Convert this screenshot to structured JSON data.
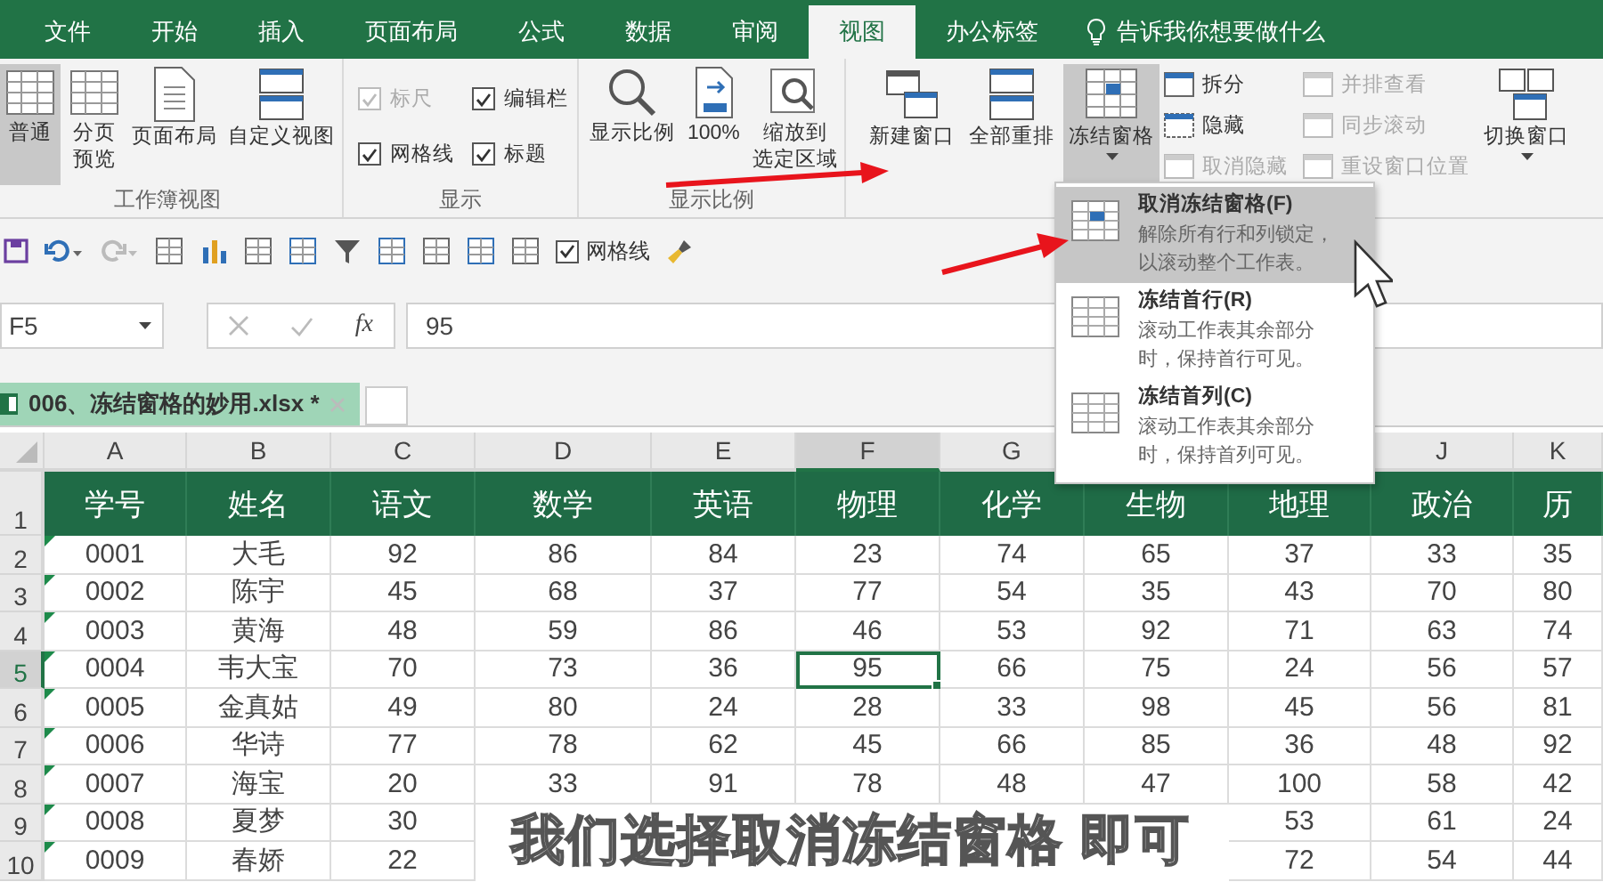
{
  "menu_tabs": [
    {
      "label": "文件",
      "selected": false
    },
    {
      "label": "开始",
      "selected": false
    },
    {
      "label": "插入",
      "selected": false
    },
    {
      "label": "页面布局",
      "selected": false
    },
    {
      "label": "公式",
      "selected": false
    },
    {
      "label": "数据",
      "selected": false
    },
    {
      "label": "审阅",
      "selected": false
    },
    {
      "label": "视图",
      "selected": true
    },
    {
      "label": "办公标签",
      "selected": false
    }
  ],
  "tell_me": {
    "placeholder": "告诉我你想要做什么"
  },
  "workbook_views": {
    "label": "工作簿视图",
    "buttons": [
      {
        "lines": [
          "普通"
        ],
        "selected": true
      },
      {
        "lines": [
          "分页",
          "预览"
        ],
        "selected": false
      },
      {
        "lines": [
          "页面布局"
        ],
        "selected": false
      },
      {
        "lines": [
          "自定义视图"
        ],
        "selected": false
      }
    ]
  },
  "show": {
    "label": "显示",
    "checkboxes": [
      {
        "label": "标尺",
        "checked": true,
        "disabled": true
      },
      {
        "label": "编辑栏",
        "checked": true,
        "disabled": false
      },
      {
        "label": "网格线",
        "checked": true,
        "disabled": false
      },
      {
        "label": "标题",
        "checked": true,
        "disabled": false
      }
    ]
  },
  "zoom": {
    "label": "显示比例",
    "buttons": [
      {
        "lines": [
          "显示比例"
        ]
      },
      {
        "lines": [
          "100%"
        ]
      },
      {
        "lines": [
          "缩放到",
          "选定区域"
        ]
      }
    ]
  },
  "window": {
    "large": [
      {
        "label": "新建窗口",
        "pressed": false,
        "dropdown": false
      },
      {
        "label": "全部重排",
        "pressed": false,
        "dropdown": false
      },
      {
        "label": "冻结窗格",
        "pressed": true,
        "dropdown": true
      }
    ],
    "small_left": [
      {
        "label": "拆分",
        "disabled": false
      },
      {
        "label": "隐藏",
        "disabled": false
      },
      {
        "label": "取消隐藏",
        "disabled": true
      }
    ],
    "small_right": [
      {
        "label": "并排查看",
        "disabled": true
      },
      {
        "label": "同步滚动",
        "disabled": true
      },
      {
        "label": "重设窗口位置",
        "disabled": true
      }
    ],
    "switch": {
      "label": "切换窗口",
      "dropdown": true
    }
  },
  "quick_access": {
    "gridlines": {
      "label": "网格线",
      "checked": true
    }
  },
  "formula_bar": {
    "name_box": "F5",
    "fx": "fx",
    "value": "95"
  },
  "workbook_tab": {
    "title": "006、冻结窗格的妙用.xlsx *"
  },
  "freeze_menu": {
    "items": [
      {
        "title": "取消冻结窗格(F)",
        "description": "解除所有行和列锁定，以滚动整个工作表。",
        "selected": true
      },
      {
        "title": "冻结首行(R)",
        "description": "滚动工作表其余部分时，保持首行可见。",
        "selected": false
      },
      {
        "title": "冻结首列(C)",
        "description": "滚动工作表其余部分时，保持首列可见。",
        "selected": false
      }
    ]
  },
  "sheet": {
    "columns": [
      {
        "letter": "A",
        "selected": false
      },
      {
        "letter": "B",
        "selected": false
      },
      {
        "letter": "C",
        "selected": false
      },
      {
        "letter": "D",
        "selected": false
      },
      {
        "letter": "E",
        "selected": false
      },
      {
        "letter": "F",
        "selected": true
      },
      {
        "letter": "G",
        "selected": false
      },
      {},
      {},
      {
        "letter": "J",
        "selected": false
      },
      {
        "letter": "K",
        "selected": false
      }
    ],
    "rows": [
      {
        "number": "1",
        "header": true,
        "selected": false,
        "text_warning": false,
        "cells": [
          "学号",
          "姓名",
          "语文",
          "数学",
          "英语",
          "物理",
          "化学",
          "生物",
          "地理",
          "政治",
          "历"
        ]
      },
      {
        "number": "2",
        "header": false,
        "selected": false,
        "text_warning": true,
        "cells": [
          "0001",
          "大毛",
          "92",
          "86",
          "84",
          "23",
          "74",
          "65",
          "37",
          "33",
          "35"
        ]
      },
      {
        "number": "3",
        "header": false,
        "selected": false,
        "text_warning": true,
        "cells": [
          "0002",
          "陈宇",
          "45",
          "68",
          "37",
          "77",
          "54",
          "35",
          "43",
          "70",
          "80"
        ]
      },
      {
        "number": "4",
        "header": false,
        "selected": false,
        "text_warning": true,
        "cells": [
          "0003",
          "黄海",
          "48",
          "59",
          "86",
          "46",
          "53",
          "92",
          "71",
          "63",
          "74"
        ]
      },
      {
        "number": "5",
        "header": false,
        "selected": true,
        "text_warning": true,
        "cells": [
          "0004",
          "韦大宝",
          "70",
          "73",
          "36",
          "95",
          "66",
          "75",
          "24",
          "56",
          "57"
        ]
      },
      {
        "number": "6",
        "header": false,
        "selected": false,
        "text_warning": true,
        "cells": [
          "0005",
          "金真姑",
          "49",
          "80",
          "24",
          "28",
          "33",
          "98",
          "45",
          "56",
          "81"
        ]
      },
      {
        "number": "7",
        "header": false,
        "selected": false,
        "text_warning": true,
        "cells": [
          "0006",
          "华诗",
          "77",
          "78",
          "62",
          "45",
          "66",
          "85",
          "36",
          "48",
          "92"
        ]
      },
      {
        "number": "8",
        "header": false,
        "selected": false,
        "text_warning": true,
        "cells": [
          "0007",
          "海宝",
          "20",
          "33",
          "91",
          "78",
          "48",
          "47",
          "100",
          "58",
          "42"
        ]
      },
      {
        "number": "9",
        "header": false,
        "selected": false,
        "text_warning": true,
        "cells": [
          "0008",
          "夏梦",
          "30",
          null,
          null,
          null,
          null,
          null,
          "53",
          "61",
          "24"
        ]
      },
      {
        "number": "10",
        "header": false,
        "selected": false,
        "text_warning": true,
        "cells": [
          "0009",
          "春娇",
          "22",
          null,
          null,
          null,
          null,
          null,
          "72",
          "54",
          "44"
        ]
      }
    ]
  },
  "subtitle": {
    "text": "我们选择取消冻结窗格 即可"
  }
}
